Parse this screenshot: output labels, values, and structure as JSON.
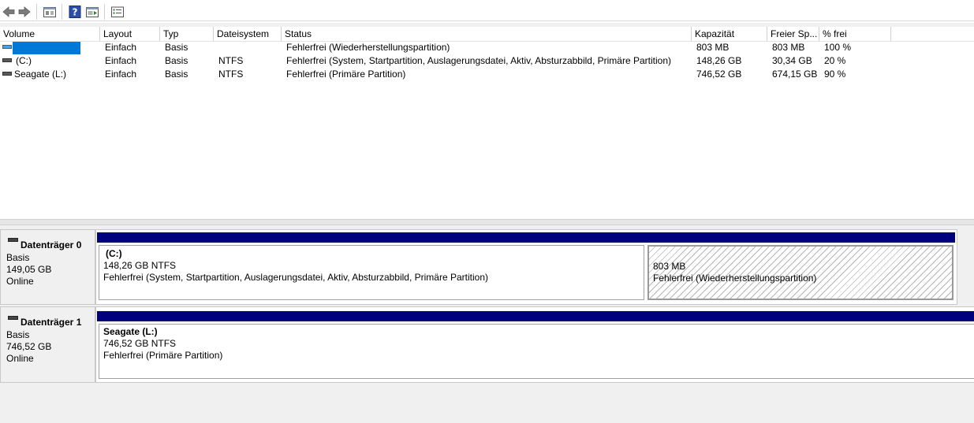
{
  "toolbar": {
    "icons": [
      "back-arrow-icon",
      "forward-arrow-icon",
      "console-view-icon",
      "help-icon",
      "action-pane-icon",
      "properties-icon"
    ]
  },
  "columns": [
    "Volume",
    "Layout",
    "Typ",
    "Dateisystem",
    "Status",
    "Kapazität",
    "Freier Sp...",
    "% frei"
  ],
  "volumes": [
    {
      "volume": "",
      "layout": "Einfach",
      "typ": "Basis",
      "fs": "",
      "status": "Fehlerfrei (Wiederherstellungspartition)",
      "kap": "803 MB",
      "frei": "803 MB",
      "pct": "100 %"
    },
    {
      "volume": "(C:)",
      "layout": "Einfach",
      "typ": "Basis",
      "fs": "NTFS",
      "status": "Fehlerfrei (System, Startpartition, Auslagerungsdatei, Aktiv, Absturzabbild, Primäre Partition)",
      "kap": "148,26 GB",
      "frei": "30,34 GB",
      "pct": "20 %"
    },
    {
      "volume": "Seagate (L:)",
      "layout": "Einfach",
      "typ": "Basis",
      "fs": "NTFS",
      "status": "Fehlerfrei (Primäre Partition)",
      "kap": "746,52 GB",
      "frei": "674,15 GB",
      "pct": "90 %"
    }
  ],
  "disks": [
    {
      "title": "Datenträger 0",
      "type": "Basis",
      "size": "149,05 GB",
      "state": "Online",
      "partitions": [
        {
          "name": "(C:)",
          "size": "148,26 GB NTFS",
          "status": "Fehlerfrei (System, Startpartition, Auslagerungsdatei, Aktiv, Absturzabbild, Primäre Partition)"
        },
        {
          "name": "",
          "size": "803 MB",
          "status": "Fehlerfrei (Wiederherstellungspartition)"
        }
      ]
    },
    {
      "title": "Datenträger 1",
      "type": "Basis",
      "size": "746,52 GB",
      "state": "Online",
      "partitions": [
        {
          "name": "Seagate  (L:)",
          "size": "746,52 GB NTFS",
          "status": "Fehlerfrei (Primäre Partition)"
        }
      ]
    }
  ]
}
